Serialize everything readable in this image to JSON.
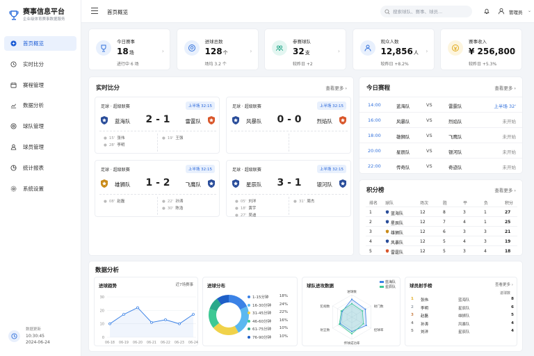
{
  "app": {
    "title": "赛事信息平台",
    "subtitle": "企业级体育赛事数据服务"
  },
  "sidebar": {
    "items": [
      {
        "label": "首页概览",
        "icon": "plus-circle-icon",
        "active": true
      },
      {
        "label": "实时比分",
        "icon": "clock-icon"
      },
      {
        "label": "赛程管理",
        "icon": "calendar-icon"
      },
      {
        "label": "数据分析",
        "icon": "chart-icon"
      },
      {
        "label": "球队管理",
        "icon": "team-icon"
      },
      {
        "label": "球员管理",
        "icon": "user-icon"
      },
      {
        "label": "统计报表",
        "icon": "report-icon"
      },
      {
        "label": "系统设置",
        "icon": "gear-icon"
      }
    ],
    "footer": {
      "label": "数据更新",
      "time": "10:30:45",
      "date": "2024-06-24"
    }
  },
  "topbar": {
    "breadcrumb": "首页概览",
    "search_placeholder": "搜索球队、赛事、球员...",
    "user": "管理员"
  },
  "stats": [
    {
      "label": "今日赛事",
      "value": "18",
      "unit": "场",
      "sub": "进行中 6 场",
      "color": "#2f6fdb",
      "bg": "#e8f0fd"
    },
    {
      "label": "进球总数",
      "value": "128",
      "unit": "个",
      "sub": "场均 3.2 个",
      "color": "#2f6fdb",
      "bg": "#e8f0fd"
    },
    {
      "label": "参赛球队",
      "value": "32",
      "unit": "支",
      "sub": "较昨日 +2",
      "color": "#24a889",
      "bg": "#e3f6f1"
    },
    {
      "label": "观众人数",
      "value": "12,856",
      "unit": "人",
      "sub": "较昨日 +8.2%",
      "color": "#2f6fdb",
      "bg": "#e8f0fd"
    },
    {
      "label": "赛事收入",
      "value": "¥ 256,800",
      "unit": "",
      "sub": "较昨日 +5.3%",
      "color": "#e0a91b",
      "bg": "#fdf5de"
    }
  ],
  "live": {
    "title": "实时比分",
    "more": "查看更多 ›",
    "matches": [
      {
        "league": "足球 · 超级联赛",
        "status": "上半场 32:15",
        "home": "蓝海队",
        "away": "雷霆队",
        "score": "2 - 1",
        "home_color": "#2a4d9a",
        "away_color": "#d9572b",
        "home_events": [
          {
            "min": "15'",
            "name": "张伟"
          },
          {
            "min": "28'",
            "name": "李明"
          }
        ],
        "away_events": [
          {
            "min": "19'",
            "name": "王强"
          }
        ]
      },
      {
        "league": "足球 · 超级联赛",
        "status": "上半场 32:15",
        "home": "风暴队",
        "away": "烈焰队",
        "score": "0 - 0",
        "home_color": "#2a4d9a",
        "away_color": "#d9572b",
        "home_events": [],
        "away_events": []
      },
      {
        "league": "足球 · 超级联赛",
        "status": "上半场 32:15",
        "home": "雄狮队",
        "away": "飞鹰队",
        "score": "1 - 2",
        "home_color": "#c98b1a",
        "away_color": "#2a4d9a",
        "home_events": [
          {
            "min": "08'",
            "name": "赵磊"
          }
        ],
        "away_events": [
          {
            "min": "22'",
            "name": "孙涛"
          },
          {
            "min": "30'",
            "name": "陈浩"
          }
        ]
      },
      {
        "league": "足球 · 超级联赛",
        "status": "上半场 32:15",
        "home": "星辰队",
        "away": "银河队",
        "score": "3 - 1",
        "home_color": "#2a4d9a",
        "away_color": "#2a4d9a",
        "home_events": [
          {
            "min": "05'",
            "name": "刘洋"
          },
          {
            "min": "18'",
            "name": "黄宇"
          },
          {
            "min": "27'",
            "name": "吴迪"
          }
        ],
        "away_events": [
          {
            "min": "31'",
            "name": "周杰"
          }
        ]
      }
    ]
  },
  "schedule": {
    "title": "今日赛程",
    "more": "查看更多 ›",
    "rows": [
      {
        "time": "14:00",
        "home": "蓝海队",
        "vs": "VS",
        "away": "雷霆队",
        "status": "上半场 32'",
        "live": true
      },
      {
        "time": "16:00",
        "home": "风暴队",
        "vs": "VS",
        "away": "烈焰队",
        "status": "未开始",
        "live": false
      },
      {
        "time": "18:00",
        "home": "雄狮队",
        "vs": "VS",
        "away": "飞鹰队",
        "status": "未开始",
        "live": false
      },
      {
        "time": "20:00",
        "home": "星辰队",
        "vs": "VS",
        "away": "银河队",
        "status": "未开始",
        "live": false
      },
      {
        "time": "22:00",
        "home": "传奇队",
        "vs": "VS",
        "away": "奇迹队",
        "status": "未开始",
        "live": false
      }
    ]
  },
  "standings": {
    "title": "积分榜",
    "more": "查看更多 ›",
    "headers": [
      "排名",
      "球队",
      "场次",
      "胜",
      "平",
      "负",
      "积分"
    ],
    "rows": [
      {
        "rank": "1",
        "team": "蓝海队",
        "played": "12",
        "w": "8",
        "d": "3",
        "l": "1",
        "pts": "27",
        "color": "#2a4d9a"
      },
      {
        "rank": "2",
        "team": "星辰队",
        "played": "12",
        "w": "7",
        "d": "4",
        "l": "1",
        "pts": "25",
        "color": "#2a4d9a"
      },
      {
        "rank": "3",
        "team": "雄狮队",
        "played": "12",
        "w": "6",
        "d": "3",
        "l": "3",
        "pts": "21",
        "color": "#c98b1a"
      },
      {
        "rank": "4",
        "team": "风暴队",
        "played": "12",
        "w": "5",
        "d": "4",
        "l": "3",
        "pts": "19",
        "color": "#2a4d9a"
      },
      {
        "rank": "5",
        "team": "雷霆队",
        "played": "12",
        "w": "5",
        "d": "3",
        "l": "4",
        "pts": "18",
        "color": "#d9572b"
      }
    ]
  },
  "analysis": {
    "title": "数据分析",
    "trend": {
      "title": "进球趋势",
      "note": "近7场赛事"
    },
    "dist": {
      "title": "进球分布"
    },
    "radar": {
      "title": "球队进攻数据"
    },
    "scorers": {
      "title": "球员射手榜",
      "more": "查看更多 ›",
      "col": "进球数",
      "rows": [
        {
          "rank": "1",
          "name": "张伟",
          "team": "蓝海队",
          "goals": "8"
        },
        {
          "rank": "2",
          "name": "李明",
          "team": "星辰队",
          "goals": "6"
        },
        {
          "rank": "3",
          "name": "赵磊",
          "team": "雄狮队",
          "goals": "5"
        },
        {
          "rank": "4",
          "name": "孙涛",
          "team": "风暴队",
          "goals": "4"
        },
        {
          "rank": "5",
          "name": "刘洋",
          "team": "星辰队",
          "goals": "4"
        }
      ]
    }
  },
  "chart_data": [
    {
      "type": "line",
      "x": [
        "06-18",
        "06-19",
        "06-20",
        "06-21",
        "06-22",
        "06-23",
        "06-24"
      ],
      "series": [
        {
          "values": [
            10,
            17,
            22,
            11,
            13,
            10,
            17
          ]
        }
      ],
      "ylim": [
        0,
        30
      ],
      "yticks": [
        0,
        10,
        20,
        30
      ],
      "color": "#3b82e6",
      "grid": true
    },
    {
      "type": "pie",
      "donut": true,
      "categories": [
        "1-15分钟",
        "16-30分钟",
        "31-45分钟",
        "46-60分钟",
        "61-75分钟",
        "76-90分钟"
      ],
      "values": [
        18,
        24,
        22,
        16,
        10,
        10
      ],
      "labels": [
        "18%",
        "24%",
        "22%",
        "16%",
        "10%",
        "10%"
      ],
      "colors": [
        "#3b82e6",
        "#5bb8f0",
        "#f0d24a",
        "#3ec995",
        "#2aa88a",
        "#1e5fc7"
      ]
    },
    {
      "type": "radar",
      "axes": [
        "进球数",
        "射门数",
        "控球率",
        "传球成功率",
        "射正数",
        "犯规数"
      ],
      "series": [
        {
          "name": "蓝海队",
          "values": [
            0.8,
            0.7,
            0.75,
            0.65,
            0.6,
            0.5
          ],
          "color": "#3b82e6"
        },
        {
          "name": "星辰队",
          "values": [
            0.6,
            0.55,
            0.6,
            0.75,
            0.65,
            0.55
          ],
          "color": "#3ec995"
        }
      ]
    }
  ]
}
